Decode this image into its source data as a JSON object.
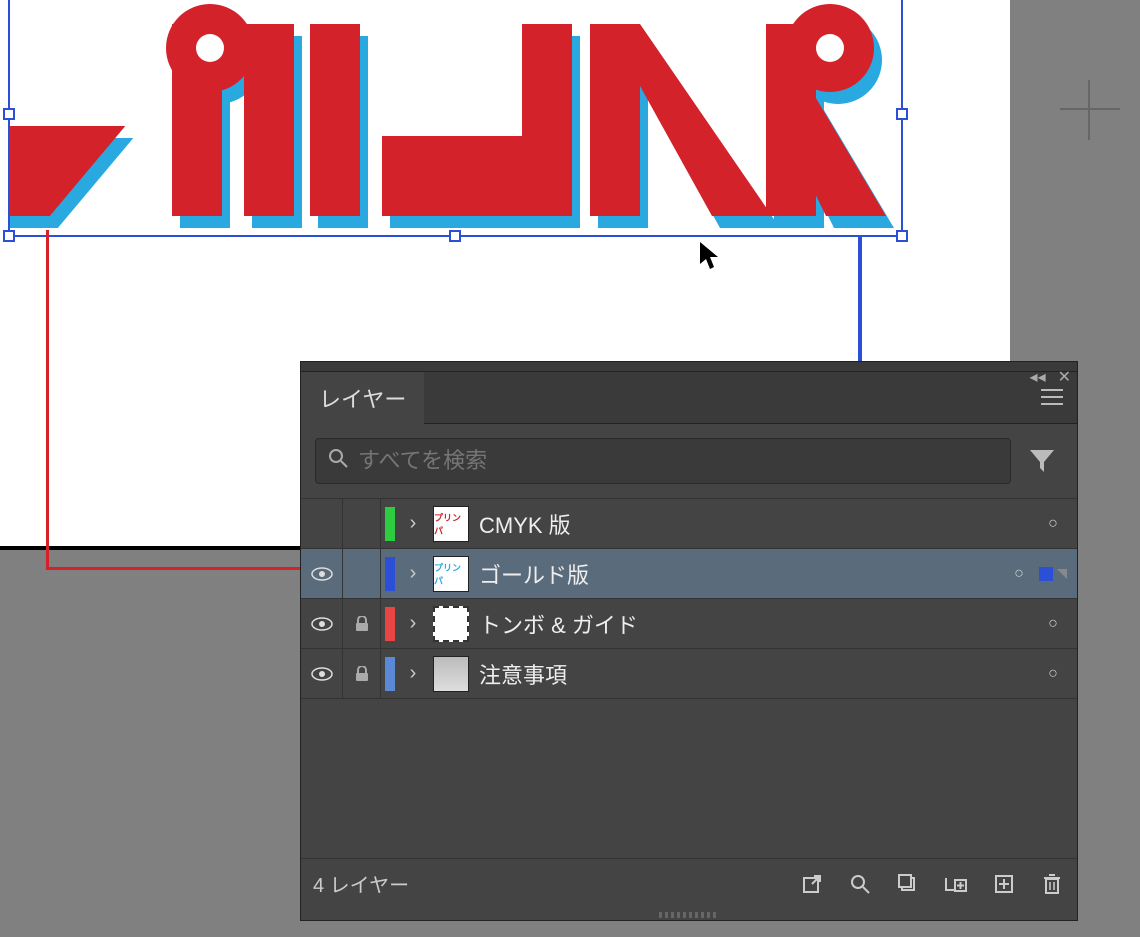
{
  "panel": {
    "tab_label": "レイヤー",
    "search_placeholder": "すべてを検索",
    "layer_count_label": "4 レイヤー"
  },
  "layers": [
    {
      "name": "CMYK 版",
      "visible": false,
      "locked": false,
      "color": "#2ecc40",
      "selected": false
    },
    {
      "name": "ゴールド版",
      "visible": true,
      "locked": false,
      "color": "#2b4fd6",
      "selected": true
    },
    {
      "name": "トンボ & ガイド",
      "visible": true,
      "locked": true,
      "color": "#e84545",
      "selected": false
    },
    {
      "name": "注意事項",
      "visible": true,
      "locked": true,
      "color": "#5a8ad6",
      "selected": false
    }
  ],
  "artwork": {
    "logo_text": "プリンパ",
    "fill_color": "#d3222a",
    "shadow_color": "#29a9e0",
    "selection_color": "#2b4fd6"
  }
}
